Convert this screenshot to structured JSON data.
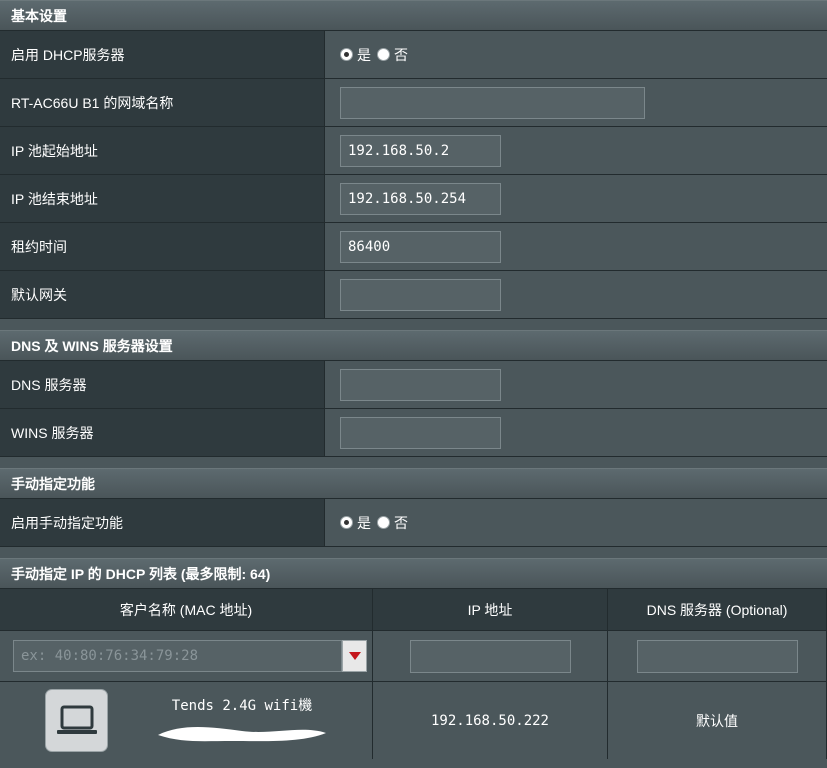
{
  "basic": {
    "title": "基本设置",
    "dhcp_label": "启用 DHCP服务器",
    "yes": "是",
    "no": "否",
    "domain_label": "RT-AC66U B1 的网域名称",
    "domain_value": "",
    "pool_start_label": "IP 池起始地址",
    "pool_start_value": "192.168.50.2",
    "pool_end_label": "IP 池结束地址",
    "pool_end_value": "192.168.50.254",
    "lease_label": "租约时间",
    "lease_value": "86400",
    "gateway_label": "默认网关",
    "gateway_value": ""
  },
  "dns": {
    "title": "DNS 及 WINS 服务器设置",
    "dns_label": "DNS 服务器",
    "wins_label": "WINS 服务器"
  },
  "manual": {
    "title": "手动指定功能",
    "enable_label": "启用手动指定功能",
    "yes": "是",
    "no": "否"
  },
  "list": {
    "title": "手动指定 IP 的 DHCP 列表 (最多限制: 64)",
    "col_client": "客户名称 (MAC 地址)",
    "col_ip": "IP 地址",
    "col_dns": "DNS 服务器 (Optional)",
    "mac_placeholder": "ex: 40:80:76:34:79:28",
    "rows": [
      {
        "name": "Tends 2.4G wifi機",
        "ip": "192.168.50.222",
        "dns": "默认值"
      }
    ]
  },
  "icons": {
    "device": "laptop-icon",
    "dropdown": "triangle-down-icon"
  },
  "colors": {
    "dropdown_arrow": "#c4161c"
  }
}
